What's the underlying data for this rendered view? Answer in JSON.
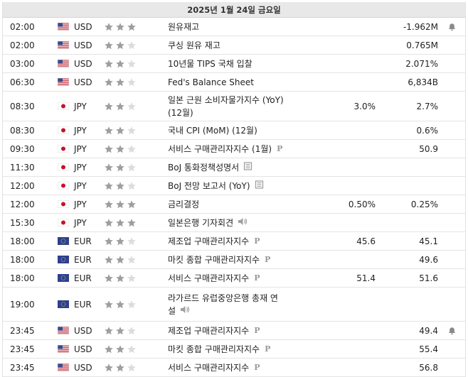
{
  "header": {
    "date": "2025년 1월 24일 금요일"
  },
  "colors": {
    "star_on": "#9e9e9e",
    "star_off": "#dcdcdc",
    "border": "#e4e4e4",
    "header_bg": "#e8e8e8"
  },
  "events": [
    {
      "time": "02:00",
      "country": "us",
      "currency": "USD",
      "importance": 3,
      "name": "원유재고",
      "name2": "",
      "icon": "",
      "actual": "",
      "forecast": "-1.962M",
      "alert": true
    },
    {
      "time": "02:00",
      "country": "us",
      "currency": "USD",
      "importance": 2,
      "name": "쿠싱 원유 재고",
      "name2": "",
      "icon": "",
      "actual": "",
      "forecast": "0.765M",
      "alert": false
    },
    {
      "time": "03:00",
      "country": "us",
      "currency": "USD",
      "importance": 2,
      "name": "10년물 TIPS 국채 입찰",
      "name2": "",
      "icon": "",
      "actual": "",
      "forecast": "2.071%",
      "alert": false
    },
    {
      "time": "06:30",
      "country": "us",
      "currency": "USD",
      "importance": 2,
      "name": "Fed's Balance Sheet",
      "name2": "",
      "icon": "",
      "actual": "",
      "forecast": "6,834B",
      "alert": false
    },
    {
      "time": "08:30",
      "country": "jp",
      "currency": "JPY",
      "importance": 2,
      "name": "일본 근원 소비자물가지수 (YoY)",
      "name2": "(12월)",
      "icon": "",
      "actual": "3.0%",
      "forecast": "2.7%",
      "alert": false
    },
    {
      "time": "08:30",
      "country": "jp",
      "currency": "JPY",
      "importance": 2,
      "name": "국내 CPI (MoM) (12월)",
      "name2": "",
      "icon": "",
      "actual": "",
      "forecast": "0.6%",
      "alert": false
    },
    {
      "time": "09:30",
      "country": "jp",
      "currency": "JPY",
      "importance": 2,
      "name": "서비스 구매관리자지수 (1월)",
      "name2": "",
      "icon": "p",
      "actual": "",
      "forecast": "50.9",
      "alert": false
    },
    {
      "time": "11:30",
      "country": "jp",
      "currency": "JPY",
      "importance": 2,
      "name": "BoJ 통화정책성명서",
      "name2": "",
      "icon": "doc",
      "actual": "",
      "forecast": "",
      "alert": false
    },
    {
      "time": "12:00",
      "country": "jp",
      "currency": "JPY",
      "importance": 2,
      "name": "BoJ 전망 보고서 (YoY)",
      "name2": "",
      "icon": "doc",
      "actual": "",
      "forecast": "",
      "alert": false
    },
    {
      "time": "12:00",
      "country": "jp",
      "currency": "JPY",
      "importance": 3,
      "name": "금리결정",
      "name2": "",
      "icon": "",
      "actual": "0.50%",
      "forecast": "0.25%",
      "alert": false
    },
    {
      "time": "15:30",
      "country": "jp",
      "currency": "JPY",
      "importance": 3,
      "name": "일본은행 기자회견",
      "name2": "",
      "icon": "speaker",
      "actual": "",
      "forecast": "",
      "alert": false
    },
    {
      "time": "18:00",
      "country": "eu",
      "currency": "EUR",
      "importance": 2,
      "name": "제조업 구매관리자지수",
      "name2": "",
      "icon": "p",
      "actual": "45.6",
      "forecast": "45.1",
      "alert": false
    },
    {
      "time": "18:00",
      "country": "eu",
      "currency": "EUR",
      "importance": 2,
      "name": "마킷 종합 구매관리자지수",
      "name2": "",
      "icon": "p",
      "actual": "",
      "forecast": "49.6",
      "alert": false
    },
    {
      "time": "18:00",
      "country": "eu",
      "currency": "EUR",
      "importance": 2,
      "name": "서비스 구매관리자지수",
      "name2": "",
      "icon": "p",
      "actual": "51.4",
      "forecast": "51.6",
      "alert": false
    },
    {
      "time": "19:00",
      "country": "eu",
      "currency": "EUR",
      "importance": 2,
      "name": "라가르드 유럽중앙은행 총재 연",
      "name2": "설",
      "icon": "speaker",
      "actual": "",
      "forecast": "",
      "alert": false
    },
    {
      "time": "23:45",
      "country": "us",
      "currency": "USD",
      "importance": 2,
      "name": "제조업 구매관리자지수",
      "name2": "",
      "icon": "p",
      "actual": "",
      "forecast": "49.4",
      "alert": true
    },
    {
      "time": "23:45",
      "country": "us",
      "currency": "USD",
      "importance": 2,
      "name": "마킷 종합 구매관리자지수",
      "name2": "",
      "icon": "p",
      "actual": "",
      "forecast": "55.4",
      "alert": false
    },
    {
      "time": "23:45",
      "country": "us",
      "currency": "USD",
      "importance": 2,
      "name": "서비스 구매관리자지수",
      "name2": "",
      "icon": "p",
      "actual": "",
      "forecast": "56.8",
      "alert": false
    }
  ]
}
